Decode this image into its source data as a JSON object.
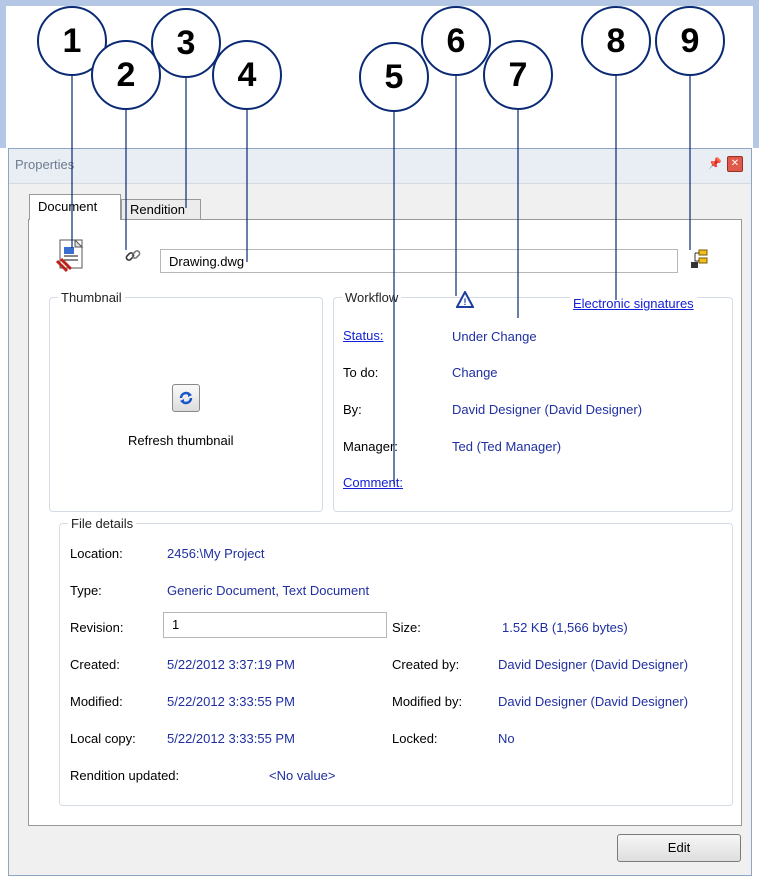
{
  "callouts": [
    "1",
    "2",
    "3",
    "4",
    "5",
    "6",
    "7",
    "8",
    "9"
  ],
  "window": {
    "title": "Properties",
    "pin_icon": "pin-icon",
    "close_icon": "close-icon"
  },
  "tabs": [
    {
      "label": "Document",
      "selected": true
    },
    {
      "label": "Rendition",
      "selected": false
    }
  ],
  "header": {
    "file_icon": "document-file-icon",
    "link_icon": "chain-link-icon",
    "filename": "Drawing.dwg",
    "structure_icon": "structure-tree-icon"
  },
  "thumbnail": {
    "legend": "Thumbnail",
    "refresh_icon": "refresh-icon",
    "refresh_label": "Refresh thumbnail"
  },
  "workflow": {
    "legend": "Workflow",
    "warning_icon": "workflow-warning-icon",
    "signatures_link": "Electronic signatures",
    "status_label": "Status:",
    "status_value": "Under Change",
    "todo_label": "To do:",
    "todo_value": "Change",
    "by_label": "By:",
    "by_value": "David Designer (David Designer)",
    "manager_label": "Manager:",
    "manager_value": "Ted (Ted Manager)",
    "comment_label": "Comment:"
  },
  "file_details": {
    "legend": "File details",
    "location_label": "Location:",
    "location_value": "2456:\\My Project",
    "type_label": "Type:",
    "type_value": "Generic Document, Text Document",
    "revision_label": "Revision:",
    "revision_value": "1",
    "size_label": "Size:",
    "size_value": "1.52 KB (1,566 bytes)",
    "created_label": "Created:",
    "created_value": "5/22/2012 3:37:19 PM",
    "created_by_label": "Created by:",
    "created_by_value": "David Designer (David Designer)",
    "modified_label": "Modified:",
    "modified_value": "5/22/2012 3:33:55 PM",
    "modified_by_label": "Modified by:",
    "modified_by_value": "David Designer (David Designer)",
    "local_copy_label": "Local copy:",
    "local_copy_value": "5/22/2012 3:33:55 PM",
    "locked_label": "Locked:",
    "locked_value": "No",
    "rendition_updated_label": "Rendition updated:",
    "rendition_updated_value": "<No value>"
  },
  "footer": {
    "edit_label": "Edit"
  },
  "colors": {
    "value_text": "#1f2fa0",
    "link_text": "#1520d6",
    "callout_border": "#0a2a74"
  }
}
